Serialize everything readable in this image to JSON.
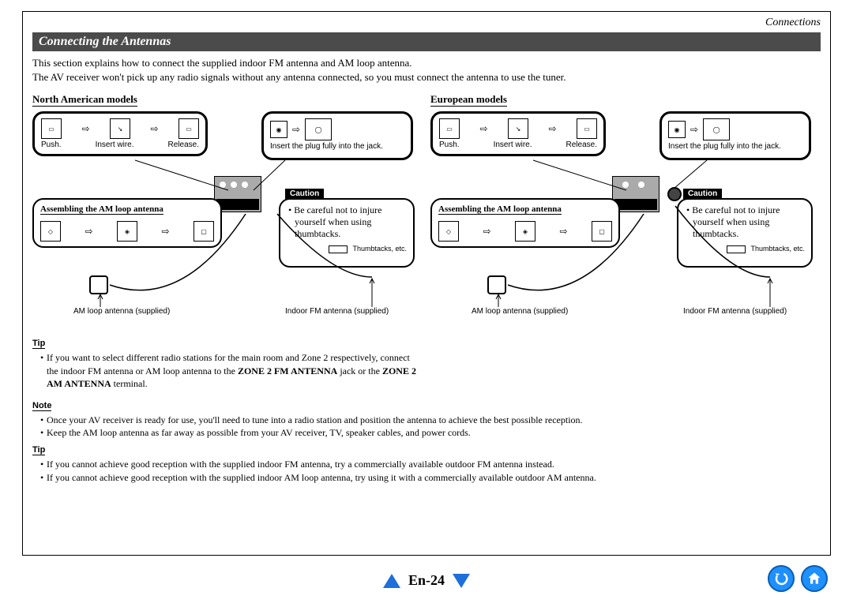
{
  "chapter": "Connections",
  "section_title": "Connecting the Antennas",
  "intro": {
    "line1": "This section explains how to connect the supplied indoor FM antenna and AM loop antenna.",
    "line2": "The AV receiver won't pick up any radio signals without any antenna connected, so you must connect the antenna to use the tuner."
  },
  "columns": {
    "na": {
      "heading": "North American models",
      "steps": {
        "push": "Push.",
        "insert": "Insert wire.",
        "release": "Release."
      },
      "fm_instruction": "Insert the plug fully into the jack.",
      "assembling_title": "Assembling the AM loop antenna",
      "caution_label": "Caution",
      "caution_text": "Be careful not to injure yourself when using thumbtacks.",
      "thumbtack_label": "Thumbtacks, etc.",
      "am_caption": "AM loop antenna (supplied)",
      "fm_caption": "Indoor FM antenna (supplied)"
    },
    "eu": {
      "heading": "European models",
      "steps": {
        "push": "Push.",
        "insert": "Insert wire.",
        "release": "Release."
      },
      "fm_instruction": "Insert the plug fully into the jack.",
      "assembling_title": "Assembling the AM loop antenna",
      "caution_label": "Caution",
      "caution_text": "Be careful not to injure yourself when using thumbtacks.",
      "thumbtack_label": "Thumbtacks, etc.",
      "am_caption": "AM loop antenna (supplied)",
      "fm_caption": "Indoor FM antenna (supplied)"
    }
  },
  "tip1": {
    "label": "Tip",
    "item_prefix": "If you want to select different radio stations for the main room and Zone 2 respectively, connect the indoor FM antenna or AM loop antenna to the ",
    "bold1": "ZONE 2 FM ANTENNA",
    "mid": " jack or the ",
    "bold2": "ZONE 2 AM ANTENNA",
    "suffix": " terminal."
  },
  "note": {
    "label": "Note",
    "items": [
      "Once your AV receiver is ready for use, you'll need to tune into a radio station and position the antenna to achieve the best possible reception.",
      "Keep the AM loop antenna as far away as possible from your AV receiver, TV, speaker cables, and power cords."
    ]
  },
  "tip2": {
    "label": "Tip",
    "items": [
      "If you cannot achieve good reception with the supplied indoor FM antenna, try a commercially available outdoor FM antenna instead.",
      "If you cannot achieve good reception with the supplied indoor AM loop antenna, try using it with a commercially available outdoor AM antenna."
    ]
  },
  "page_number": "En-24"
}
